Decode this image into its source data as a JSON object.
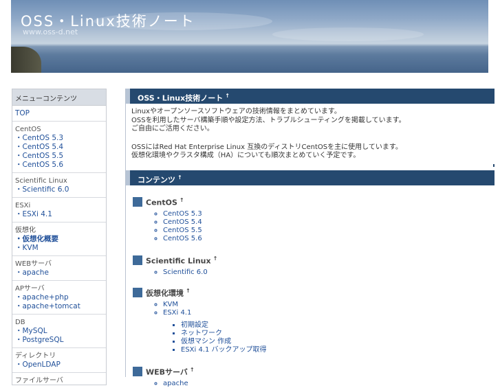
{
  "header": {
    "title": "OSS・Linux技術ノート",
    "url": "www.oss-d.net"
  },
  "sidebar": {
    "heading": "メニューコンテンツ",
    "top": "TOP",
    "groups": [
      {
        "title": "CentOS",
        "links": [
          "・CentOS 5.3",
          "・CentOS 5.4",
          "・CentOS 5.5",
          "・CentOS 5.6"
        ]
      },
      {
        "title": "Scientific Linux",
        "links": [
          "・Scientific 6.0"
        ]
      },
      {
        "title": "ESXi",
        "links": [
          "・ESXi 4.1"
        ]
      },
      {
        "title": "仮想化",
        "links": [
          "・仮想化概要",
          "・KVM"
        ]
      },
      {
        "title": "WEBサーバ",
        "links": [
          "・apache"
        ]
      },
      {
        "title": "APサーバ",
        "links": [
          "・apache+php",
          "・apache+tomcat"
        ]
      },
      {
        "title": "DB",
        "links": [
          "・MySQL",
          "・PostgreSQL"
        ]
      },
      {
        "title": "ディレクトリ",
        "links": [
          "・OpenLDAP"
        ]
      },
      {
        "title": "ファイルサーバ",
        "links": []
      }
    ]
  },
  "main": {
    "section1": {
      "title": "OSS・Linux技術ノート",
      "up": "↑",
      "para1_line1": "Linuxやオープンソースソフトウェアの技術情報をまとめています。",
      "para1_line2": "OSSを利用したサーバ構築手順や設定方法、トラブルシューティングを掲載しています。",
      "para1_line3": "ご自由にご活用ください。",
      "para2_line1": "OSSにはRed Hat Enterprise Linux 互換のディストリCentOSを主に使用しています。",
      "para2_line2": "仮想化環境やクラスタ構成（HA）についても順次まとめていく予定です。"
    },
    "section2": {
      "title": "コンテンツ",
      "up": "↑",
      "groups": [
        {
          "title": "CentOS",
          "up": "↑",
          "items": [
            "CentOS 5.3",
            "CentOS 5.4",
            "CentOS 5.5",
            "CentOS 5.6"
          ]
        },
        {
          "title": "Scientific Linux",
          "up": "↑",
          "items": [
            "Scientific 6.0"
          ]
        },
        {
          "title": "仮想化環境",
          "up": "↑",
          "items": [
            "KVM",
            "ESXi 4.1"
          ],
          "subitems": [
            "初期設定",
            "ネットワーク",
            "仮想マシン 作成",
            "ESXi 4.1 バックアップ取得"
          ]
        },
        {
          "title": "WEBサーバ",
          "up": "↑",
          "items": [
            "apache"
          ]
        }
      ]
    }
  },
  "colors": {
    "section_header_bg": "#25496f",
    "link": "#1f4f99",
    "square_marker": "#3e6a99",
    "sidebar_head_bg": "#d8dde4"
  }
}
